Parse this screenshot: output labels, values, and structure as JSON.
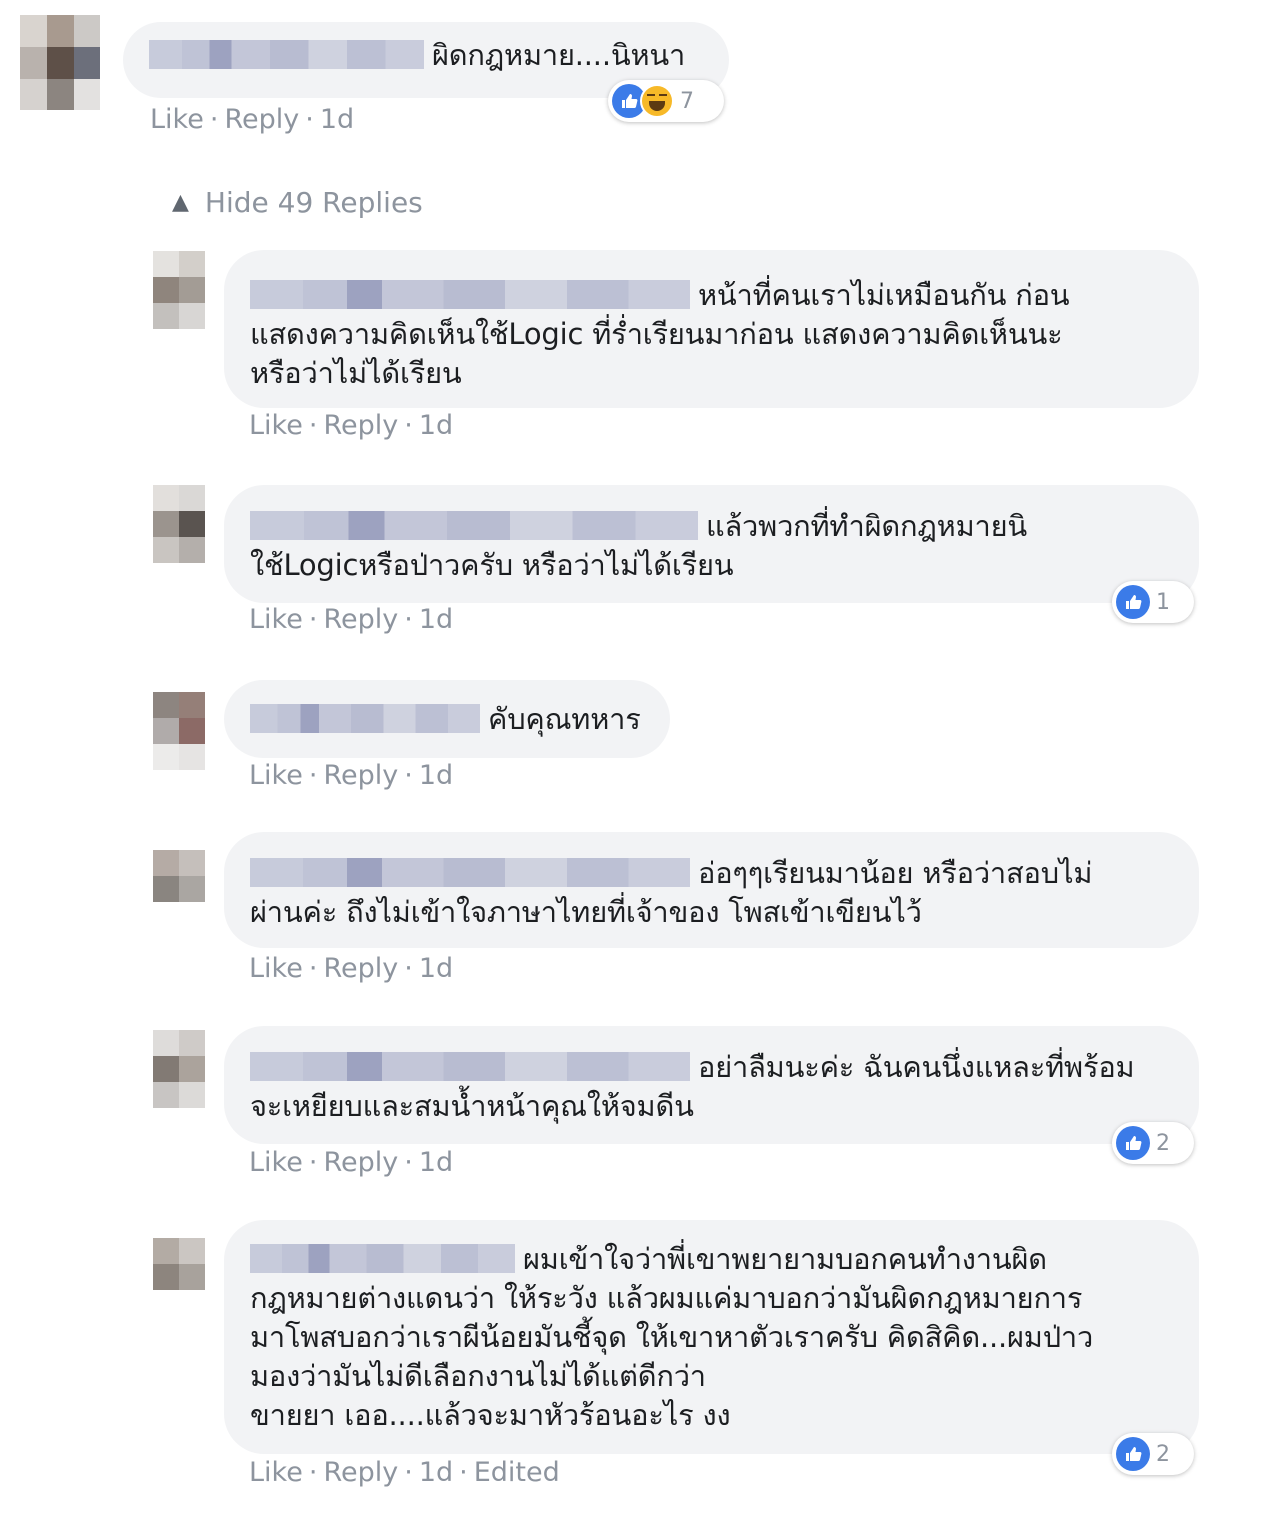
{
  "thread": {
    "hide_replies_label": "Hide 49 Replies"
  },
  "comments": [
    {
      "text": "ผิดกฎหมาย....นิหนา",
      "like_label": "Like",
      "reply_label": "Reply",
      "time": "1d",
      "edited": "",
      "reactions": [
        "like-icon",
        "haha-icon"
      ],
      "reaction_count": "7"
    },
    {
      "text": "หน้าที่คนเราไม่เหมือนกัน ก่อน\nแสดงความคิดเห็นใช้Logic ที่ร่ำเรียนมาก่อน แสดงความคิดเห็นนะ\nหรือว่าไม่ได้เรียน",
      "like_label": "Like",
      "reply_label": "Reply",
      "time": "1d",
      "edited": "",
      "reactions": [],
      "reaction_count": ""
    },
    {
      "text": "แล้วพวกที่ทำผิดกฎหมายนิ\nใช้Logicหรือป่าวครับ หรือว่าไม่ได้เรียน",
      "like_label": "Like",
      "reply_label": "Reply",
      "time": "1d",
      "edited": "",
      "reactions": [
        "like-icon"
      ],
      "reaction_count": "1"
    },
    {
      "text": "คับคุณทหาร",
      "like_label": "Like",
      "reply_label": "Reply",
      "time": "1d",
      "edited": "",
      "reactions": [],
      "reaction_count": ""
    },
    {
      "text": "อ่อๆๆเรียนมาน้อย หรือว่าสอบไม่\nผ่านค่ะ ถึงไม่เข้าใจภาษาไทยที่เจ้าของ โพสเข้าเขียนไว้",
      "like_label": "Like",
      "reply_label": "Reply",
      "time": "1d",
      "edited": "",
      "reactions": [],
      "reaction_count": ""
    },
    {
      "text": "อย่าลืมนะค่ะ ฉันคนนึ่งแหละที่พร้อม\nจะเหยียบและสมน้ำหน้าคุณให้จมดีน",
      "like_label": "Like",
      "reply_label": "Reply",
      "time": "1d",
      "edited": "",
      "reactions": [
        "like-icon"
      ],
      "reaction_count": "2"
    },
    {
      "text": "ผมเข้าใจว่าพี่เขาพยายามบอกคนทำงานผิด\nกฎหมายต่างแดนว่า ให้ระวัง แล้วผมแค่มาบอกว่ามันผิดกฎหมายการ\nมาโพสบอกว่าเราผีน้อยมันชี้จุด ให้เขาหาตัวเราครับ คิดสิคิด...ผมป่าว\nมองว่ามันไม่ดีเลือกงานไม่ได้แต่ดีกว่า\nขายยา เออ....แล้วจะมาหัวร้อนอะไร งง",
      "like_label": "Like",
      "reply_label": "Reply",
      "time": "1d",
      "edited": "Edited",
      "reactions": [
        "like-icon"
      ],
      "reaction_count": "2"
    }
  ]
}
